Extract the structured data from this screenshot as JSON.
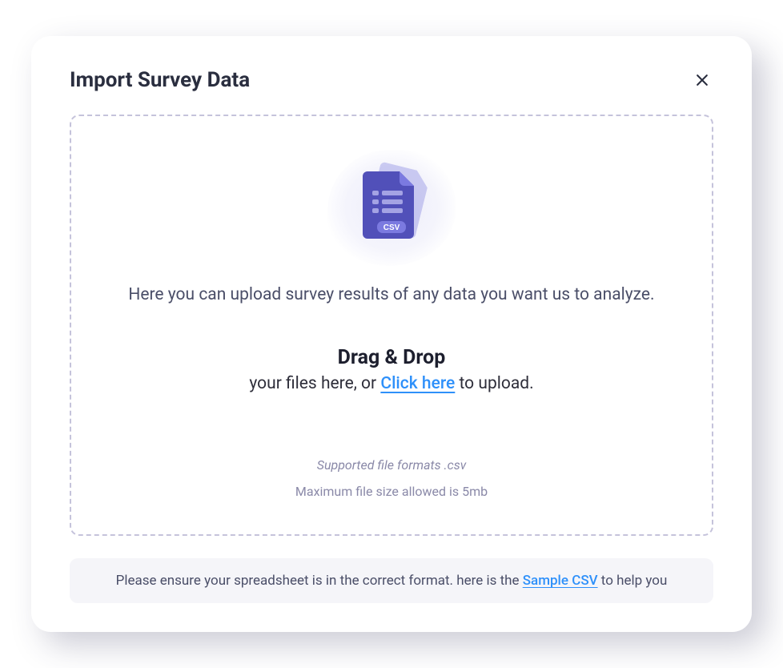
{
  "modal": {
    "title": "Import Survey Data"
  },
  "dropzone": {
    "description": "Here you can upload survey results of any data you want us to analyze.",
    "drag_title": "Drag & Drop",
    "sub_prefix": "your files here, or ",
    "click_label": "Click here",
    "sub_suffix": " to upload.",
    "supported": "Supported file formats .csv",
    "maxsize": "Maximum file size allowed is 5mb",
    "csv_badge": "CSV"
  },
  "footer": {
    "prefix": "Please ensure your spreadsheet is in the correct format. here is the ",
    "link_label": "Sample CSV",
    "suffix": " to help you"
  }
}
